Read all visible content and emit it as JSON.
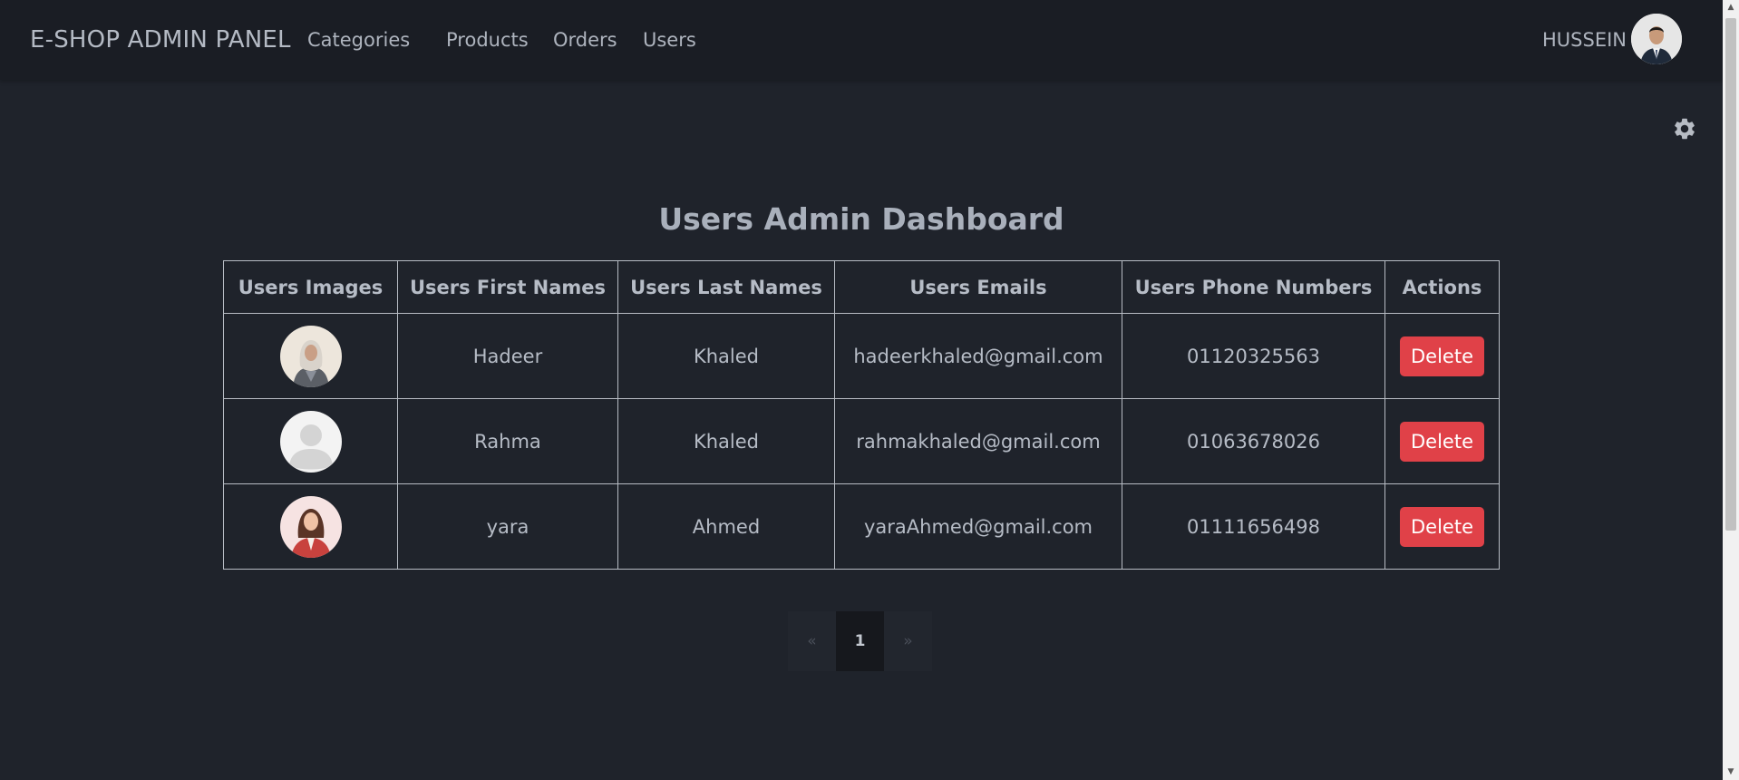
{
  "navbar": {
    "brand": "E-SHOP ADMIN PANEL",
    "links": [
      "Categories",
      "Products",
      "Orders",
      "Users"
    ],
    "user_name": "HUSSEIN"
  },
  "page": {
    "title": "Users Admin Dashboard"
  },
  "table": {
    "headers": [
      "Users Images",
      "Users First Names",
      "Users Last Names",
      "Users Emails",
      "Users Phone Numbers",
      "Actions"
    ],
    "rows": [
      {
        "first": "Hadeer",
        "last": "Khaled",
        "email": "hadeerkhaled@gmail.com",
        "phone": "01120325563",
        "action": "Delete"
      },
      {
        "first": "Rahma",
        "last": "Khaled",
        "email": "rahmakhaled@gmail.com",
        "phone": "01063678026",
        "action": "Delete"
      },
      {
        "first": "yara",
        "last": "Ahmed",
        "email": "yaraAhmed@gmail.com",
        "phone": "01111656498",
        "action": "Delete"
      }
    ]
  },
  "pagination": {
    "prev": "«",
    "current": "1",
    "next": "»"
  },
  "icons": {
    "settings": "gear-icon"
  },
  "colors": {
    "background": "#1f232b",
    "navbar": "#1a1d24",
    "delete": "#e04148"
  }
}
